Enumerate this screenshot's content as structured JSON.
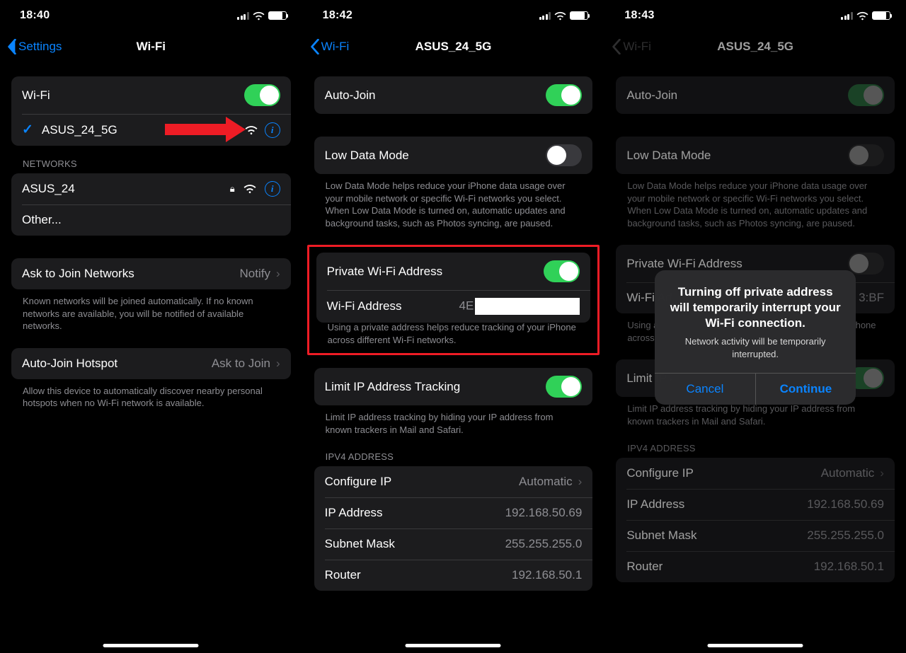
{
  "screen1": {
    "time": "18:40",
    "back": "Settings",
    "title": "Wi-Fi",
    "wifi_label": "Wi-Fi",
    "connected_network": "ASUS_24_5G",
    "networks_header": "NETWORKS",
    "other_network": "ASUS_24",
    "other_label": "Other...",
    "ask_join_label": "Ask to Join Networks",
    "ask_join_value": "Notify",
    "ask_join_help": "Known networks will be joined automatically. If no known networks are available, you will be notified of available networks.",
    "auto_hotspot_label": "Auto-Join Hotspot",
    "auto_hotspot_value": "Ask to Join",
    "auto_hotspot_help": "Allow this device to automatically discover nearby personal hotspots when no Wi-Fi network is available."
  },
  "screen2": {
    "time": "18:42",
    "back": "Wi-Fi",
    "title": "ASUS_24_5G",
    "auto_join": "Auto-Join",
    "low_data": "Low Data Mode",
    "low_data_help": "Low Data Mode helps reduce your iPhone data usage over your mobile network or specific Wi-Fi networks you select. When Low Data Mode is turned on, automatic updates and background tasks, such as Photos syncing, are paused.",
    "private_wifi": "Private Wi-Fi Address",
    "wifi_addr_label": "Wi-Fi Address",
    "wifi_addr_prefix": "4E",
    "private_help": "Using a private address helps reduce tracking of your iPhone across different Wi-Fi networks.",
    "limit_ip": "Limit IP Address Tracking",
    "limit_ip_help": "Limit IP address tracking by hiding your IP address from known trackers in Mail and Safari.",
    "ipv4_header": "IPV4 ADDRESS",
    "configure_ip": "Configure IP",
    "configure_ip_val": "Automatic",
    "ip_addr_label": "IP Address",
    "ip_addr_val": "192.168.50.69",
    "subnet_label": "Subnet Mask",
    "subnet_val": "255.255.255.0",
    "router_label": "Router",
    "router_val": "192.168.50.1"
  },
  "screen3": {
    "time": "18:43",
    "back": "Wi-Fi",
    "title": "ASUS_24_5G",
    "wifi_addr_suffix": "3:BF",
    "alert_title": "Turning off private address will temporarily interrupt your Wi-Fi connection.",
    "alert_msg": "Network activity will be temporarily interrupted.",
    "alert_cancel": "Cancel",
    "alert_continue": "Continue"
  }
}
